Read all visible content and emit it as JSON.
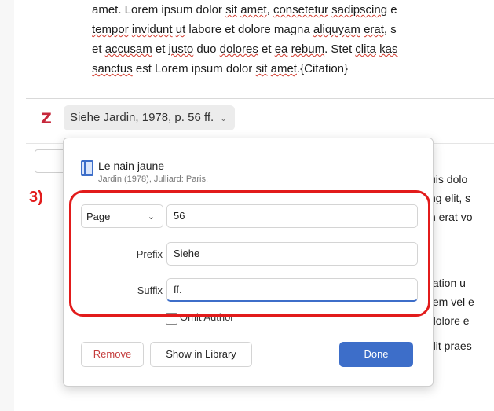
{
  "document": {
    "lines": [
      {
        "parts": [
          [
            "amet. Lorem ipsum dolor ",
            false
          ],
          [
            "sit",
            true
          ],
          [
            " ",
            false
          ],
          [
            "amet",
            true
          ],
          [
            ", ",
            false
          ],
          [
            "consetetur",
            true
          ],
          [
            " ",
            false
          ],
          [
            "sadipscing",
            true
          ],
          [
            " e",
            false
          ]
        ]
      },
      {
        "parts": [
          [
            "tempor",
            true
          ],
          [
            " ",
            false
          ],
          [
            "invidunt",
            true
          ],
          [
            " ",
            false
          ],
          [
            "ut",
            true
          ],
          [
            " labore et dolore magna ",
            false
          ],
          [
            "aliquyam",
            true
          ],
          [
            " ",
            false
          ],
          [
            "erat",
            true
          ],
          [
            ", s",
            false
          ]
        ]
      },
      {
        "parts": [
          [
            "et ",
            false
          ],
          [
            "accusam",
            true
          ],
          [
            " et ",
            false
          ],
          [
            "justo",
            true
          ],
          [
            " duo ",
            false
          ],
          [
            "dolores",
            true
          ],
          [
            " et ",
            false
          ],
          [
            "ea",
            true
          ],
          [
            " ",
            false
          ],
          [
            "rebum",
            true
          ],
          [
            ". Stet ",
            false
          ],
          [
            "clita",
            true
          ],
          [
            " ",
            false
          ],
          [
            "kas",
            true
          ]
        ]
      },
      {
        "parts": [
          [
            "sanctus",
            true
          ],
          [
            " est Lorem ipsum dolor ",
            false
          ],
          [
            "sit",
            true
          ],
          [
            " ",
            false
          ],
          [
            "amet",
            true
          ],
          [
            ".{Citation}",
            false
          ]
        ]
      }
    ],
    "right_fragments": [
      "uis dolo",
      "ng elit, s",
      "n erat vo",
      "tation u",
      "tem vel e",
      "dolore e",
      "dit praes"
    ]
  },
  "zotero_bar": {
    "logo": "Z",
    "citation_pill": "Siehe Jardin, 1978, p. 56 ff."
  },
  "popup": {
    "item_title": "Le nain jaune",
    "item_sub": "Jardin (1978), Julliard: Paris.",
    "locator_type": "Page",
    "locator_value": "56",
    "prefix_label": "Prefix",
    "prefix_value": "Siehe",
    "suffix_label": "Suffix",
    "suffix_value": "ff.",
    "omit_author_label": "Omit Author",
    "remove_label": "Remove",
    "library_label": "Show in Library",
    "done_label": "Done"
  },
  "annotation": {
    "label": "3)"
  },
  "colors": {
    "accent": "#3d6ec9",
    "zotero_red": "#c6273a",
    "annotation_red": "#e21b1b",
    "remove_red": "#c43b3b"
  }
}
